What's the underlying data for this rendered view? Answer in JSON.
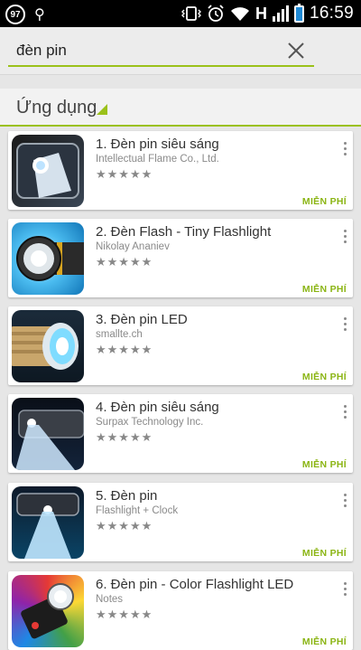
{
  "statusbar": {
    "notif_count": "97",
    "network_label": "H",
    "time": "16:59"
  },
  "search": {
    "query": "đèn pin"
  },
  "section": {
    "title": "Ứng dụng"
  },
  "apps": [
    {
      "title": "1. Đèn pin siêu sáng",
      "developer": "Intellectual Flame Co., Ltd.",
      "rating": "★★★★★",
      "price": "MIỄN PHÍ"
    },
    {
      "title": "2. Đèn Flash - Tiny Flashlight",
      "developer": "Nikolay Ananiev",
      "rating": "★★★★★",
      "price": "MIỄN PHÍ"
    },
    {
      "title": "3. Đèn pin LED",
      "developer": "smallte.ch",
      "rating": "★★★★★",
      "price": "MIỄN PHÍ"
    },
    {
      "title": "4. Đèn pin siêu sáng",
      "developer": "Surpax Technology Inc.",
      "rating": "★★★★★",
      "price": "MIỄN PHÍ"
    },
    {
      "title": "5. Đèn pin",
      "developer": "Flashlight + Clock",
      "rating": "★★★★★",
      "price": "MIỄN PHÍ"
    },
    {
      "title": "6. Đèn pin - Color Flashlight LED",
      "developer": "Notes",
      "rating": "★★★★★",
      "price": "MIỄN PHÍ"
    }
  ],
  "colors": {
    "accent": "#9bc11a",
    "price": "#8bb514",
    "statusbar": "#000000"
  }
}
